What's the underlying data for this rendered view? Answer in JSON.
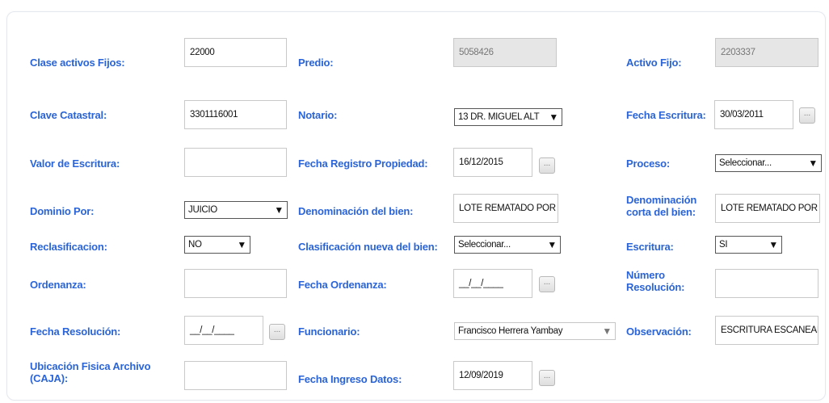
{
  "form": {
    "clase_activos": {
      "label": "Clase activos Fijos:",
      "value": "22000"
    },
    "predio": {
      "label": "Predio:",
      "value": "5058426"
    },
    "activo_fijo": {
      "label": "Activo Fijo:",
      "value": "2203337"
    },
    "clave_catastral": {
      "label": "Clave Catastral:",
      "value": "3301116001"
    },
    "notario": {
      "label": "Notario:",
      "value": "13 DR. MIGUEL ALT"
    },
    "fecha_escritura": {
      "label": "Fecha Escritura:",
      "value": "30/03/2011"
    },
    "valor_escritura": {
      "label": "Valor de Escritura:",
      "value": ""
    },
    "fecha_registro": {
      "label": "Fecha Registro Propiedad:",
      "value": "16/12/2015"
    },
    "proceso": {
      "label": "Proceso:",
      "value": "Seleccionar..."
    },
    "dominio_por": {
      "label": "Dominio Por:",
      "value": "JUICIO"
    },
    "denominacion_bien": {
      "label": "Denominación del bien:",
      "value": "LOTE REMATADO POR"
    },
    "denominacion_corta": {
      "label_line1": "Denominación",
      "label_line2": "corta del bien:",
      "value": "LOTE REMATADO POR"
    },
    "reclasificacion": {
      "label": "Reclasificacion:",
      "value": "NO"
    },
    "clasificacion_nueva": {
      "label": "Clasificación nueva del bien:",
      "value": "Seleccionar..."
    },
    "escritura": {
      "label": "Escritura:",
      "value": "SI"
    },
    "ordenanza": {
      "label": "Ordenanza:",
      "value": ""
    },
    "fecha_ordenanza": {
      "label": "Fecha Ordenanza:",
      "value": "__/__/____"
    },
    "numero_resolucion": {
      "label_line1": "Número",
      "label_line2": "Resolución:",
      "value": ""
    },
    "fecha_resolucion": {
      "label": "Fecha Resolución:",
      "value": "__/__/____"
    },
    "funcionario": {
      "label": "Funcionario:",
      "value": "Francisco Herrera Yambay"
    },
    "observacion": {
      "label": "Observación:",
      "value": "ESCRITURA ESCANEAI"
    },
    "ubicacion": {
      "label_line1": "Ubicación Fisica Archivo",
      "label_line2": "(CAJA):",
      "value": ""
    },
    "fecha_ingreso": {
      "label": "Fecha Ingreso Datos:",
      "value": "12/09/2019"
    }
  },
  "ui": {
    "calendar_button": "...",
    "dropdown_caret": "▼",
    "accent_color": "#2a64d6"
  }
}
